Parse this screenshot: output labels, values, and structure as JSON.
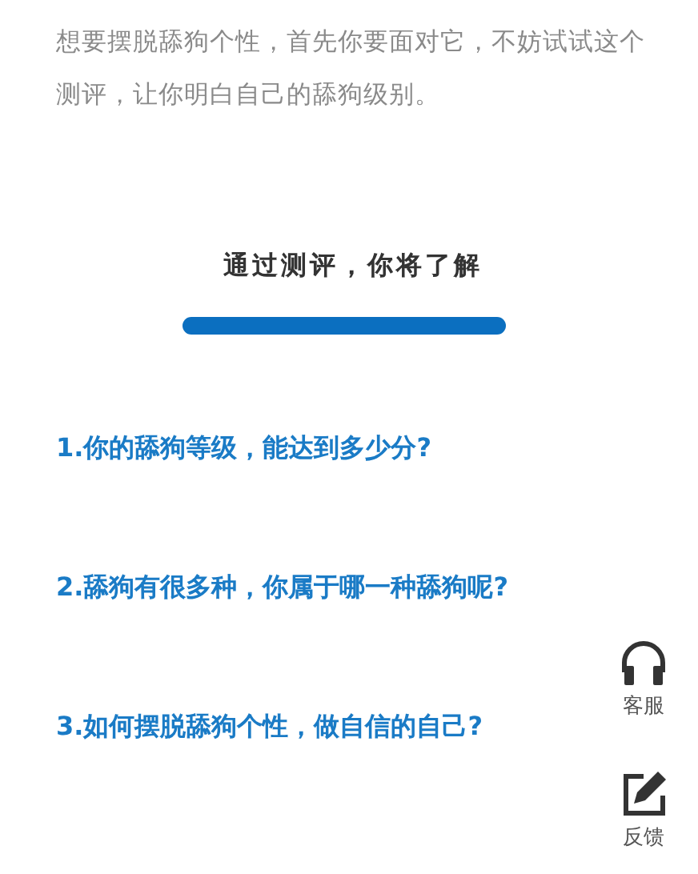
{
  "intro": "想要摆脱舔狗个性，首先你要面对它，不妨试试这个测评，让你明白自己的舔狗级别。",
  "section_title": "通过测评，你将了解",
  "questions": [
    "1.你的舔狗等级，能达到多少分?",
    "2.舔狗有很多种，你属于哪一种舔狗呢?",
    "3.如何摆脱舔狗个性，做自信的自己?"
  ],
  "float_buttons": [
    {
      "kind": "support",
      "label": "客服"
    },
    {
      "kind": "feedback",
      "label": "反馈"
    }
  ]
}
